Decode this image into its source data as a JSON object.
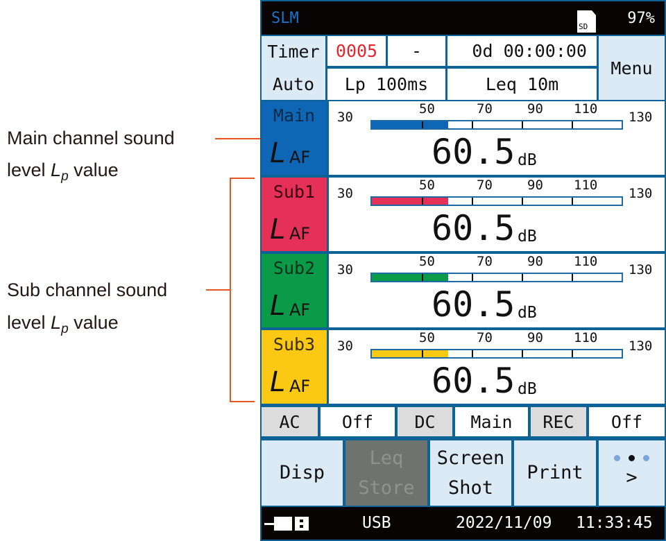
{
  "annotations": {
    "main": {
      "line1": "Main channel sound",
      "line2_pre": "level ",
      "L": "L",
      "p": "p",
      "line2_post": " value"
    },
    "sub": {
      "line1": "Sub channel sound",
      "line2_pre": "level ",
      "L": "L",
      "p": "p",
      "line2_post": " value"
    }
  },
  "status_bar": {
    "app": "SLM",
    "sd_label": "SD",
    "battery": "97%"
  },
  "header": {
    "timer": "Timer",
    "auto": "Auto",
    "counter": "0005",
    "dash": "-",
    "elapsed": "0d 00:00:00",
    "lp_interval": "Lp 100ms",
    "leq_interval": "Leq 10m",
    "menu": "Menu"
  },
  "scale": {
    "min": "30",
    "max": "130",
    "ticks": [
      "50",
      "70",
      "90",
      "110"
    ]
  },
  "channels": [
    {
      "name": "Main",
      "symbol": "L",
      "weighting": "AF",
      "value": "60.5",
      "unit": "dB",
      "level": 60.5,
      "color": "#0e66b4",
      "text_color": "#0a2a4a"
    },
    {
      "name": "Sub1",
      "symbol": "L",
      "weighting": "AF",
      "value": "60.5",
      "unit": "dB",
      "level": 60.5,
      "color": "#e53057",
      "text_color": "#3a0010"
    },
    {
      "name": "Sub2",
      "symbol": "L",
      "weighting": "AF",
      "value": "60.5",
      "unit": "dB",
      "level": 60.5,
      "color": "#0b9b48",
      "text_color": "#04301a"
    },
    {
      "name": "Sub3",
      "symbol": "L",
      "weighting": "AF",
      "value": "60.5",
      "unit": "dB",
      "level": 60.5,
      "color": "#fbc913",
      "text_color": "#3a2e00"
    }
  ],
  "io_row": {
    "ac": "AC",
    "ac_val": "Off",
    "dc": "DC",
    "dc_val": "Main",
    "rec": "REC",
    "rec_val": "Off"
  },
  "function_keys": {
    "disp": "Disp",
    "leq_1": "Leq",
    "leq_2": "Store",
    "shot_1": "Screen",
    "shot_2": "Shot",
    "print": "Print",
    "next": ">"
  },
  "bottom_bar": {
    "usb": "USB",
    "date": "2022/11/09",
    "time": "11:33:45"
  }
}
